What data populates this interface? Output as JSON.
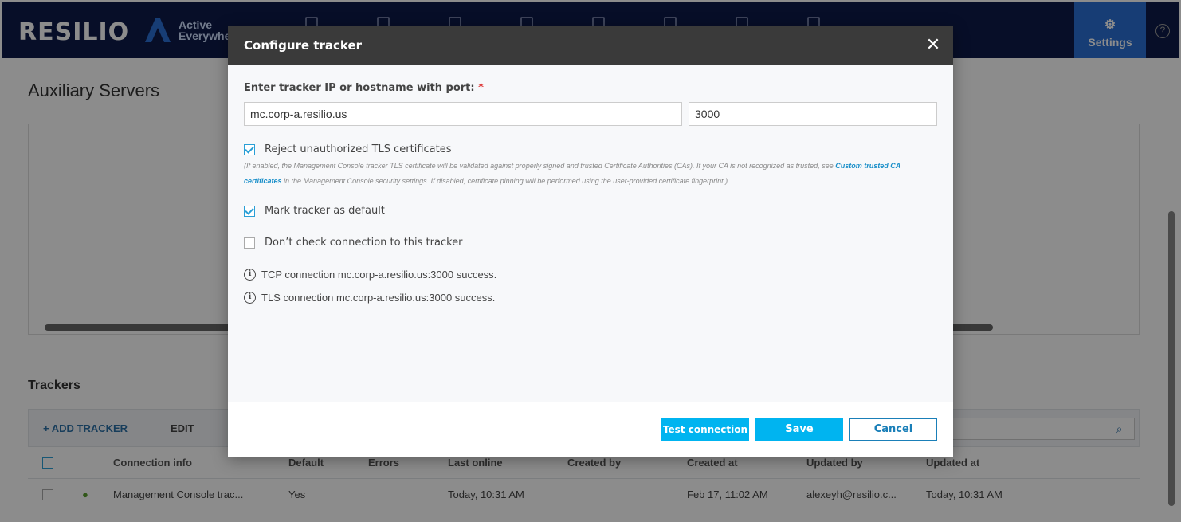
{
  "app": {
    "brand": "RESILIO",
    "product_line1": "Active",
    "product_line2": "Everywhe",
    "settings_label": "Settings",
    "help_symbol": "?"
  },
  "page": {
    "title": "Auxiliary Servers"
  },
  "trackers": {
    "section_title": "Trackers",
    "add_label": "+ ADD TRACKER",
    "edit_label": "EDIT",
    "columns": [
      "Connection info",
      "Default",
      "Errors",
      "Last online",
      "Created by",
      "Created at",
      "Updated by",
      "Updated at"
    ],
    "row": {
      "connection_info": "Management Console trac...",
      "default": "Yes",
      "errors": "",
      "last_online": "Today, 10:31 AM",
      "created_by": "",
      "created_at": "Feb 17, 11:02 AM",
      "updated_by": "alexeyh@resilio.c...",
      "updated_at": "Today, 10:31 AM"
    }
  },
  "modal": {
    "title": "Configure tracker",
    "close_symbol": "✕",
    "field_label": "Enter tracker IP or hostname with port:",
    "required_mark": "*",
    "host_value": "mc.corp-a.resilio.us",
    "port_value": "3000",
    "reject_tls": {
      "label": "Reject unauthorized TLS certificates",
      "checked": true
    },
    "hint_part1": "(If enabled, the Management Console tracker TLS certificate will be validated against properly signed and trusted Certificate Authorities (CAs).  If your CA is not recognized as trusted, see ",
    "hint_link": "Custom trusted CA certificates",
    "hint_part2": " in the Management Console security settings.  If disabled, certificate pinning will be performed using the user-provided certificate fingerprint.)",
    "mark_default": {
      "label": "Mark tracker as default",
      "checked": true
    },
    "dont_check": {
      "label": "Don’t check connection to this tracker",
      "checked": false
    },
    "tcp_status": "TCP connection mc.corp-a.resilio.us:3000 success.",
    "tls_status": "TLS connection mc.corp-a.resilio.us:3000 success.",
    "buttons": {
      "test": "Test connection",
      "save": "Save",
      "cancel": "Cancel"
    }
  },
  "colors": {
    "accent": "#00b4f0",
    "header_bg": "#3a3a3a",
    "topbar_bg": "#0e1a4a"
  }
}
